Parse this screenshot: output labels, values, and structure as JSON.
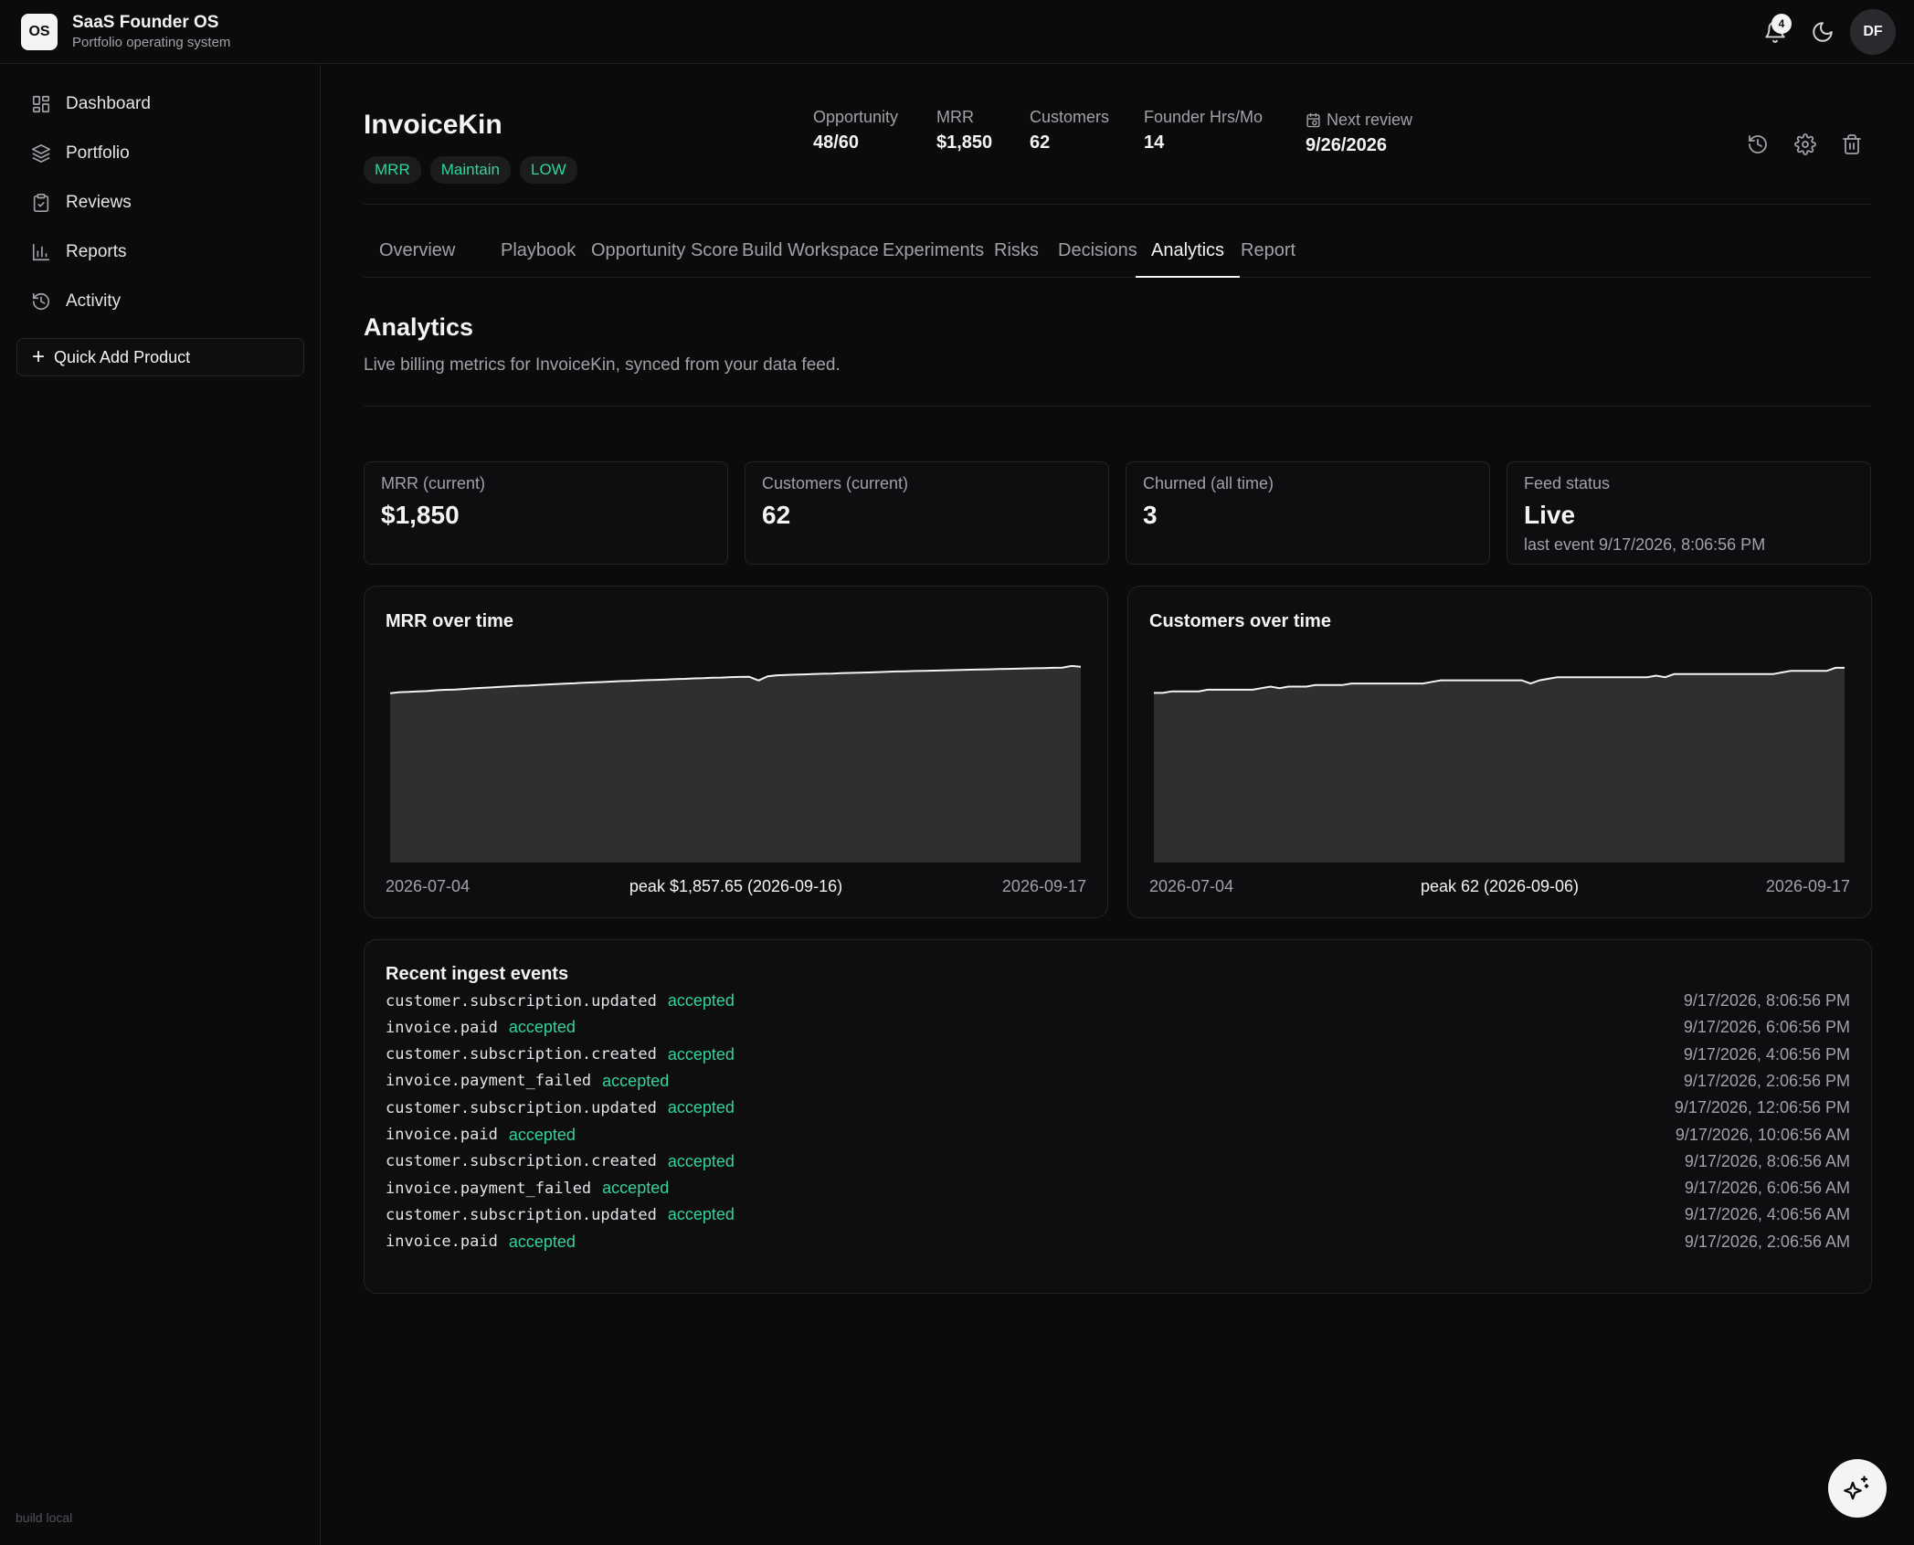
{
  "app": {
    "logo": "OS",
    "title": "SaaS Founder OS",
    "subtitle": "Portfolio operating system",
    "build": "build local"
  },
  "header": {
    "notifications_count": "4",
    "avatar_initials": "DF",
    "icons": [
      "bell-icon",
      "moon-icon"
    ]
  },
  "sidebar": {
    "items": [
      {
        "label": "Dashboard",
        "icon": "grid-icon"
      },
      {
        "label": "Portfolio",
        "icon": "layers-icon"
      },
      {
        "label": "Reviews",
        "icon": "clipboard-icon"
      },
      {
        "label": "Reports",
        "icon": "bar-chart-icon"
      },
      {
        "label": "Activity",
        "icon": "history-icon"
      }
    ],
    "quick_add": "Quick Add Product"
  },
  "product": {
    "name": "InvoiceKin",
    "tags": [
      "MRR",
      "Maintain",
      "LOW"
    ],
    "stats": [
      {
        "label": "Opportunity",
        "value": "48/60"
      },
      {
        "label": "MRR",
        "value": "$1,850"
      },
      {
        "label": "Customers",
        "value": "62"
      },
      {
        "label": "Founder Hrs/Mo",
        "value": "14"
      }
    ],
    "next_review": {
      "label": "Next review",
      "value": "9/26/2026"
    },
    "actions": [
      "history-icon",
      "gear-icon",
      "trash-icon"
    ]
  },
  "tabs": [
    "Overview",
    "Playbook",
    "Opportunity Score",
    "Build Workspace",
    "Experiments",
    "Risks",
    "Decisions",
    "Analytics",
    "Report"
  ],
  "active_tab": "Analytics",
  "analytics": {
    "title": "Analytics",
    "description": "Live billing metrics for InvoiceKin, synced from your data feed.",
    "kpis": [
      {
        "label": "MRR (current)",
        "value": "$1,850",
        "sub": ""
      },
      {
        "label": "Customers (current)",
        "value": "62",
        "sub": ""
      },
      {
        "label": "Churned (all time)",
        "value": "3",
        "sub": ""
      },
      {
        "label": "Feed status",
        "value": "Live",
        "sub": "last event 9/17/2026, 8:06:56 PM"
      }
    ]
  },
  "chart_data": [
    {
      "type": "area",
      "title": "MRR over time",
      "x_start": "2026-07-04",
      "x_end": "2026-09-17",
      "peak_label": "peak $1,857.65 (2026-09-16)",
      "ylim": [
        0,
        1900
      ],
      "values": [
        1600,
        1610,
        1612,
        1618,
        1620,
        1628,
        1632,
        1635,
        1640,
        1646,
        1650,
        1655,
        1660,
        1664,
        1670,
        1672,
        1678,
        1682,
        1686,
        1690,
        1694,
        1700,
        1702,
        1706,
        1710,
        1714,
        1716,
        1720,
        1724,
        1726,
        1730,
        1734,
        1736,
        1740,
        1742,
        1746,
        1748,
        1752,
        1754,
        1756,
        1720,
        1760,
        1770,
        1772,
        1776,
        1778,
        1782,
        1784,
        1786,
        1790,
        1792,
        1794,
        1796,
        1800,
        1802,
        1806,
        1808,
        1810,
        1812,
        1814,
        1816,
        1818,
        1820,
        1822,
        1824,
        1826,
        1828,
        1830,
        1832,
        1834,
        1836,
        1838,
        1840,
        1842,
        1857.65,
        1850
      ]
    },
    {
      "type": "area",
      "title": "Customers over time",
      "x_start": "2026-07-04",
      "x_end": "2026-09-17",
      "peak_label": "peak 62 (2026-09-06)",
      "ylim": [
        0,
        64
      ],
      "values": [
        54,
        54,
        54.5,
        54.5,
        54.5,
        54.5,
        55,
        55,
        55,
        55,
        55,
        55,
        55.5,
        56,
        55.5,
        56,
        56,
        56,
        56.5,
        56.5,
        56.5,
        56.5,
        57,
        57,
        57,
        57,
        57,
        57,
        57,
        57,
        57,
        57.5,
        58,
        58,
        58,
        58,
        58,
        58,
        58,
        58,
        58,
        58,
        57,
        58,
        58.5,
        59,
        59,
        59,
        59,
        59,
        59,
        59,
        59,
        59,
        59,
        59,
        59.5,
        59,
        60,
        60,
        60,
        60,
        60,
        60,
        60,
        60,
        60,
        60,
        60,
        60,
        60.5,
        61,
        61,
        61,
        61,
        61,
        62,
        62
      ]
    }
  ],
  "events": {
    "title": "Recent ingest events",
    "rows": [
      {
        "name": "customer.subscription.updated",
        "status": "accepted",
        "time": "9/17/2026, 8:06:56 PM"
      },
      {
        "name": "invoice.paid",
        "status": "accepted",
        "time": "9/17/2026, 6:06:56 PM"
      },
      {
        "name": "customer.subscription.created",
        "status": "accepted",
        "time": "9/17/2026, 4:06:56 PM"
      },
      {
        "name": "invoice.payment_failed",
        "status": "accepted",
        "time": "9/17/2026, 2:06:56 PM"
      },
      {
        "name": "customer.subscription.updated",
        "status": "accepted",
        "time": "9/17/2026, 12:06:56 PM"
      },
      {
        "name": "invoice.paid",
        "status": "accepted",
        "time": "9/17/2026, 10:06:56 AM"
      },
      {
        "name": "customer.subscription.created",
        "status": "accepted",
        "time": "9/17/2026, 8:06:56 AM"
      },
      {
        "name": "invoice.payment_failed",
        "status": "accepted",
        "time": "9/17/2026, 6:06:56 AM"
      },
      {
        "name": "customer.subscription.updated",
        "status": "accepted",
        "time": "9/17/2026, 4:06:56 AM"
      },
      {
        "name": "invoice.paid",
        "status": "accepted",
        "time": "9/17/2026, 2:06:56 AM"
      }
    ]
  },
  "colors": {
    "accent": "#34d399",
    "background": "#0b0b0c",
    "card": "#0e0e10",
    "area_fill": "#2f2f32",
    "line": "#f4f4f5"
  }
}
